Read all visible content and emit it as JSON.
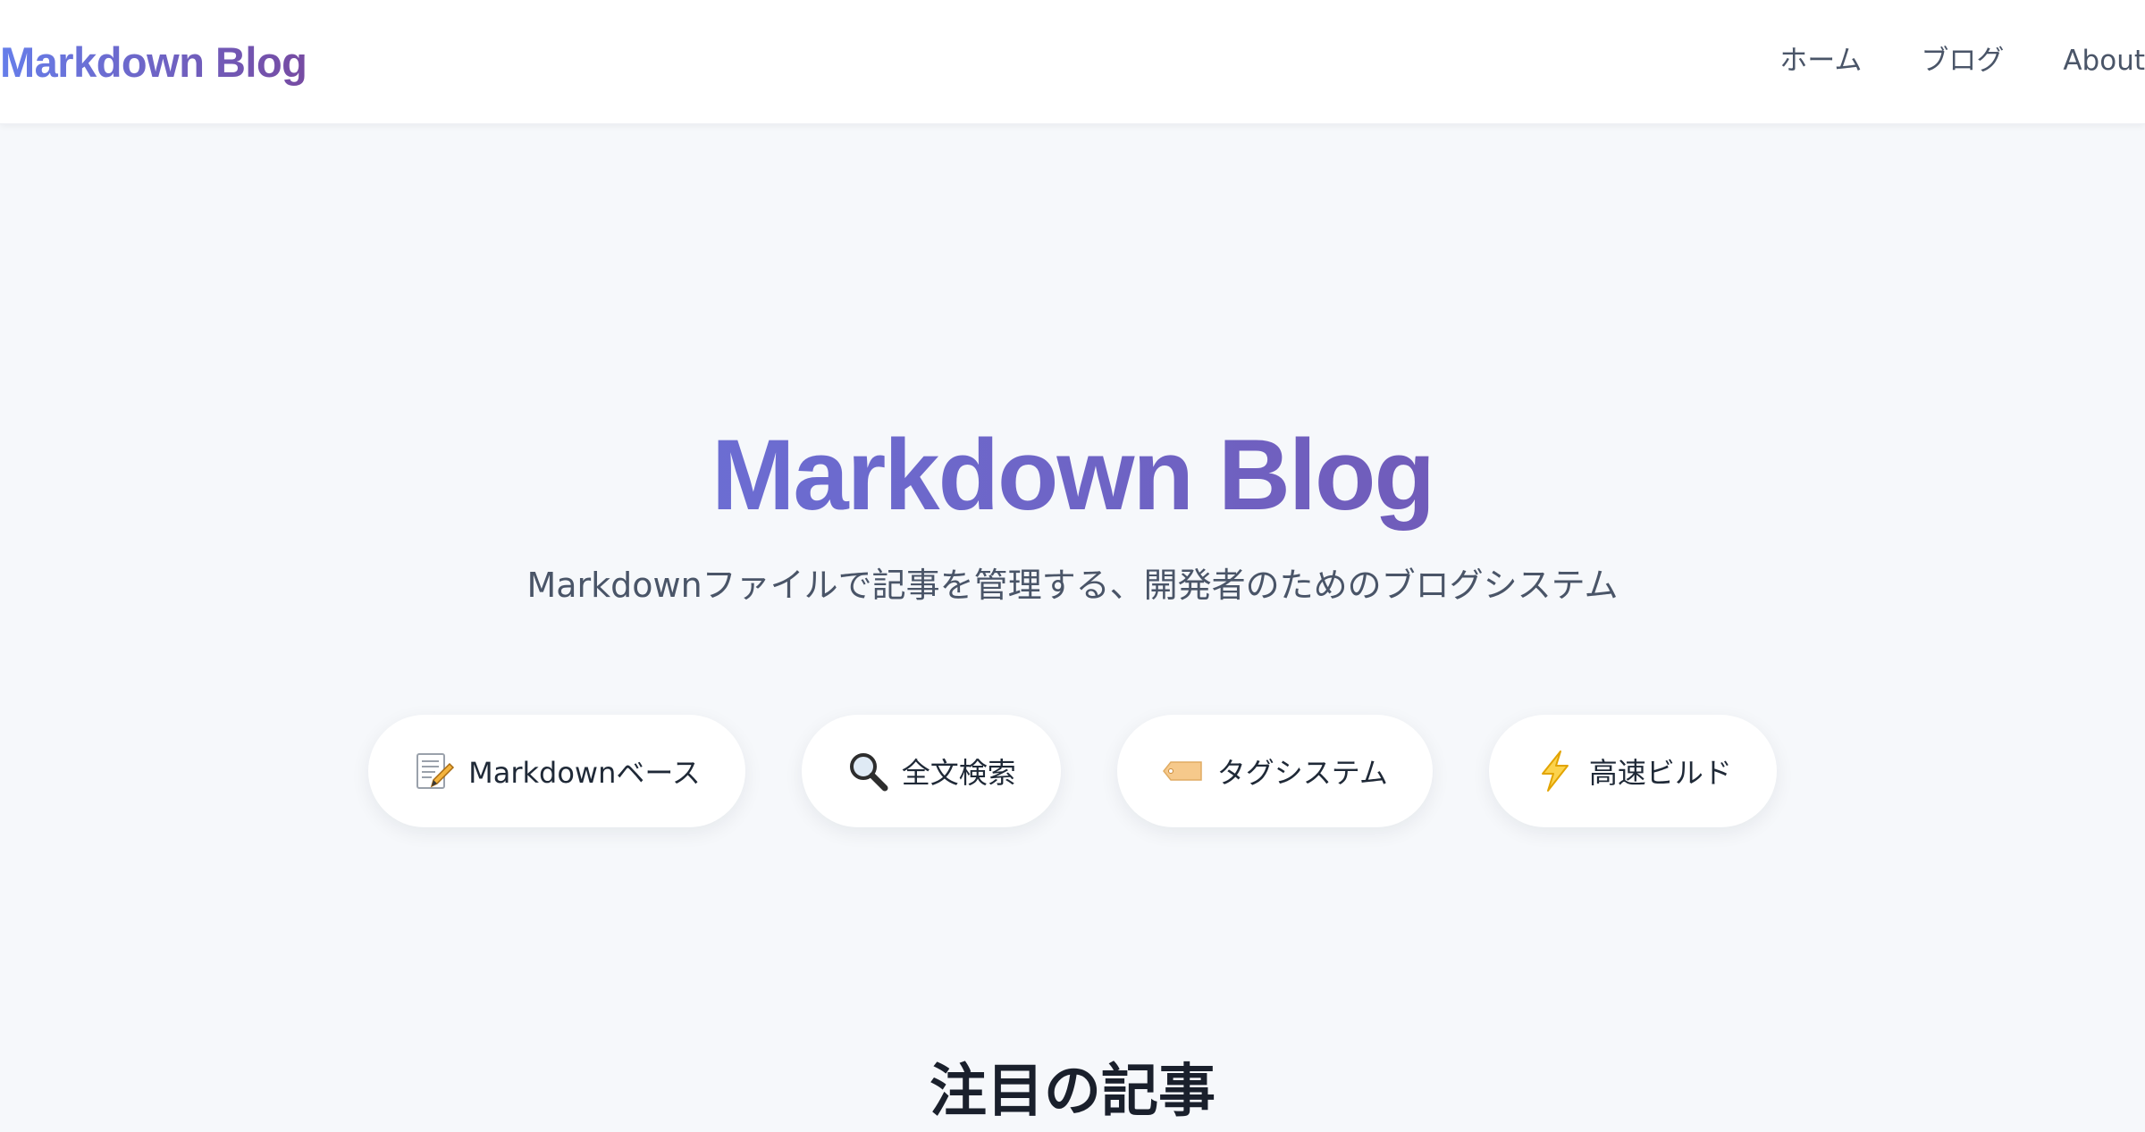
{
  "navbar": {
    "brand": "Markdown Blog",
    "links": [
      {
        "label": "ホーム"
      },
      {
        "label": "ブログ"
      },
      {
        "label": "About"
      }
    ]
  },
  "hero": {
    "title": "Markdown Blog",
    "subtitle": "Markdownファイルで記事を管理する、開発者のためのブログシステム",
    "features": [
      {
        "icon": "memo-icon",
        "label": "Markdownベース"
      },
      {
        "icon": "magnifier-icon",
        "label": "全文検索"
      },
      {
        "icon": "tag-icon",
        "label": "タグシステム"
      },
      {
        "icon": "lightning-icon",
        "label": "高速ビルド"
      }
    ]
  },
  "featured": {
    "title": "注目の記事"
  },
  "colors": {
    "gradient_start": "#667eea",
    "gradient_end": "#764ba2",
    "background": "#f6f8fb",
    "lightning": "#f5b400",
    "tag": "#f6c98b"
  }
}
